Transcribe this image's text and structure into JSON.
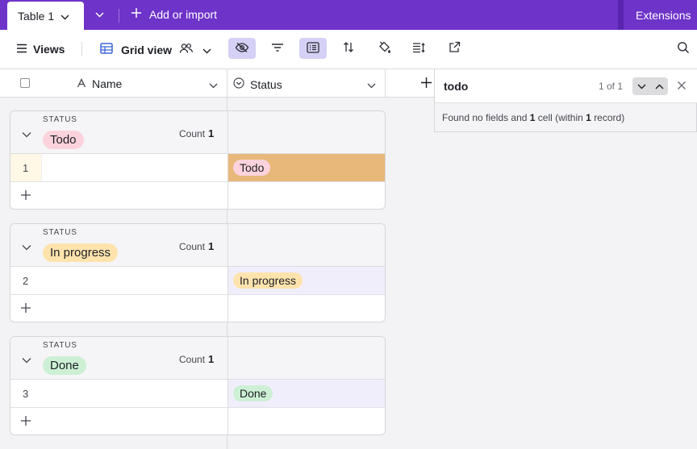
{
  "topbar": {
    "active_tab": "Table 1",
    "add_import": "Add or import",
    "extensions": "Extensions"
  },
  "toolbar": {
    "views": "Views",
    "grid_view": "Grid view"
  },
  "grid": {
    "columns": [
      {
        "label": "Name",
        "icon": "text-field-icon"
      },
      {
        "label": "Status",
        "icon": "single-select-icon"
      }
    ],
    "groups": [
      {
        "group_label": "STATUS",
        "value": "Todo",
        "color": "#fcd3dc",
        "count_label": "Count",
        "count": "1",
        "rows": [
          {
            "num": "1",
            "name": "",
            "status": "Todo",
            "highlighted": true
          }
        ]
      },
      {
        "group_label": "STATUS",
        "value": "In progress",
        "color": "#ffe3ad",
        "count_label": "Count",
        "count": "1",
        "rows": [
          {
            "num": "2",
            "name": "",
            "status": "In progress",
            "highlighted": false
          }
        ]
      },
      {
        "group_label": "STATUS",
        "value": "Done",
        "color": "#cdf0d5",
        "count_label": "Count",
        "count": "1",
        "rows": [
          {
            "num": "3",
            "name": "",
            "status": "Done",
            "highlighted": false
          }
        ]
      }
    ]
  },
  "search": {
    "query": "todo",
    "counter": "1 of 1",
    "result_prefix": "Found no fields and",
    "result_cells": "1",
    "result_middle": "cell (within",
    "result_records": "1",
    "result_suffix": "record)"
  },
  "colors": {
    "brand_purple": "#6e33c9",
    "highlight_cell": "#e8b87a",
    "search_match_row": "#f1eefc"
  }
}
